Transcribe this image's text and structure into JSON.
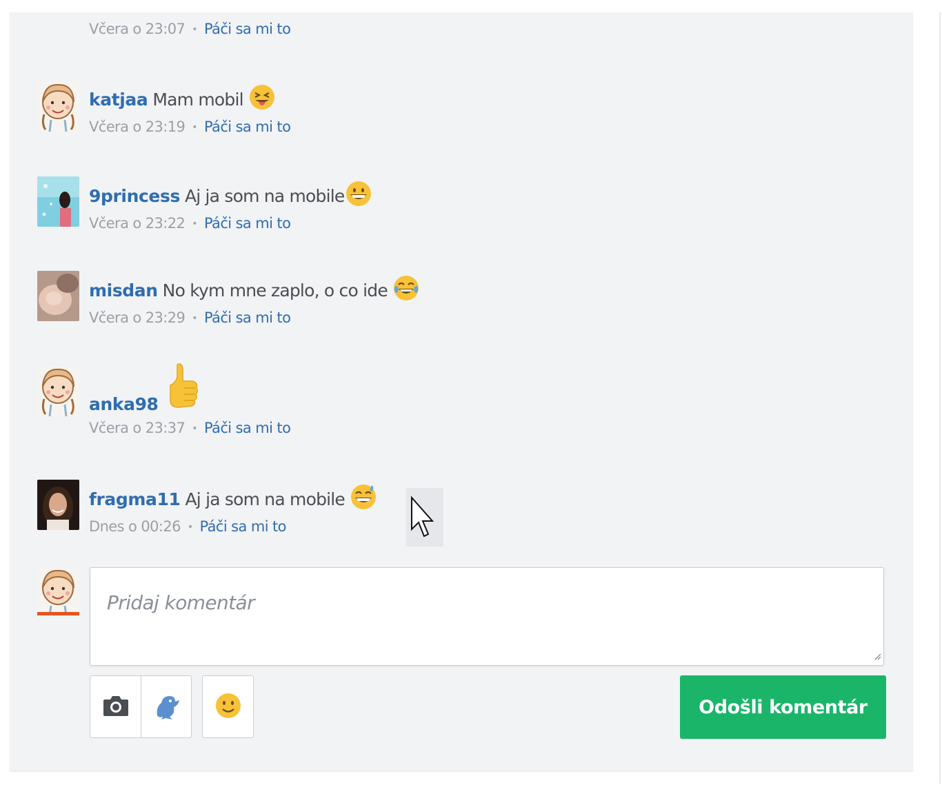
{
  "top_meta": {
    "time": "Včera o 23:07",
    "like": "Páči sa mi to"
  },
  "comments": [
    {
      "user": "katjaa",
      "text": "Mam mobil",
      "emoji": "tongue-out-emoji",
      "time": "Včera o 23:19",
      "like": "Páči sa mi to",
      "avatar": "cartoon-girl-avatar"
    },
    {
      "user": "9princess",
      "text": "Aj ja som na mobile",
      "emoji": "grin-emoji",
      "time": "Včera o 23:22",
      "like": "Páči sa mi to",
      "avatar": "photo-avatar"
    },
    {
      "user": "misdan",
      "text": "No kym mne zaplo, o co ide",
      "emoji": "tears-of-joy-emoji",
      "time": "Včera o 23:29",
      "like": "Páči sa mi to",
      "avatar": "photo-avatar"
    },
    {
      "user": "anka98",
      "text": "",
      "emoji": "thumbs-up-emoji",
      "time": "Včera o 23:37",
      "like": "Páči sa mi to",
      "avatar": "cartoon-girl-avatar"
    },
    {
      "user": "fragma11",
      "text": "Aj ja som na mobile",
      "emoji": "grin-sweat-emoji",
      "time": "Dnes o 00:26",
      "like": "Páči sa mi to",
      "avatar": "photo-avatar"
    }
  ],
  "composer": {
    "placeholder": "Pridaj komentár",
    "send_label": "Odošli komentár",
    "tools": [
      "camera-icon",
      "sticker-icon",
      "smiley-icon"
    ]
  },
  "colors": {
    "link": "#2f6db0",
    "send": "#1bb56a",
    "avatar_underline": "#e8541e",
    "panel": "#f2f3f5"
  }
}
